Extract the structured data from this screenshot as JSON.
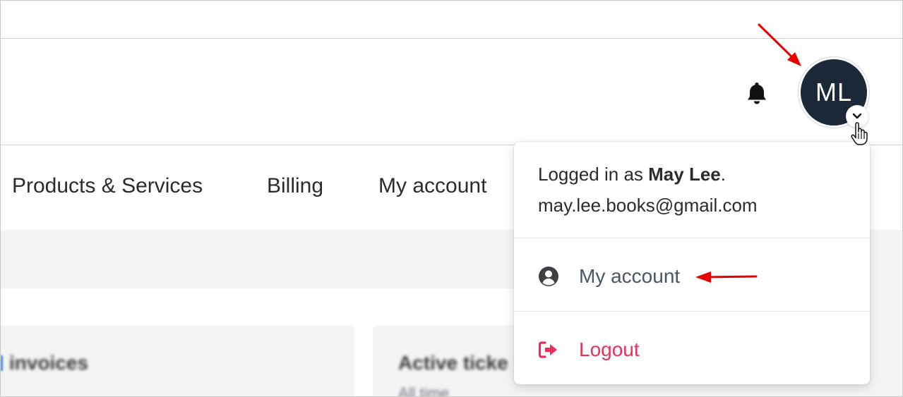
{
  "header": {
    "bell_icon": "bell-icon",
    "avatar_initials": "ML",
    "avatar_color": "#1d2838",
    "avatar_chevron_icon": "chevron-down-icon"
  },
  "nav": {
    "items": [
      {
        "label": "Products & Services"
      },
      {
        "label": "Billing"
      },
      {
        "label": "My account"
      }
    ]
  },
  "cards": [
    {
      "title": "invoices",
      "subtitle": ""
    },
    {
      "title": "Active ticke",
      "subtitle": "All time"
    }
  ],
  "user_menu": {
    "logged_in_prefix": "Logged in as ",
    "user_name": "May Lee",
    "logged_in_suffix": ".",
    "email": "may.lee.books@gmail.com",
    "items": [
      {
        "label": "My account",
        "icon": "user-circle-icon",
        "color": "#4b5563"
      },
      {
        "label": "Logout",
        "icon": "sign-out-icon",
        "color": "#e8305a"
      }
    ]
  },
  "annotations": {
    "arrow_color": "#e60000"
  }
}
